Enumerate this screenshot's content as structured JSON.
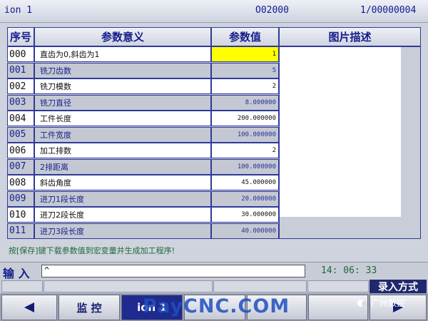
{
  "titlebar": {
    "left": "ion 1",
    "middle": "O02000",
    "right": "1/00000004"
  },
  "table": {
    "headers": {
      "no": "序号",
      "meaning": "参数意义",
      "value": "参数值",
      "image": "图片描述"
    },
    "rows": [
      {
        "no": "000",
        "name": "直齿为0,斜齿为1",
        "value": "1"
      },
      {
        "no": "001",
        "name": "铣刀齿数",
        "value": "5"
      },
      {
        "no": "002",
        "name": "铣刀模数",
        "value": "2"
      },
      {
        "no": "003",
        "name": "铣刀直径",
        "value": "8.000000"
      },
      {
        "no": "004",
        "name": "工件长度",
        "value": "200.000000"
      },
      {
        "no": "005",
        "name": "工件宽度",
        "value": "100.000000"
      },
      {
        "no": "006",
        "name": "加工排数",
        "value": "2"
      },
      {
        "no": "007",
        "name": "2排距离",
        "value": "100.000000"
      },
      {
        "no": "008",
        "name": "斜齿角度",
        "value": "45.000000"
      },
      {
        "no": "009",
        "name": "进刀1段长度",
        "value": "20.000000"
      },
      {
        "no": "010",
        "name": "进刀2段长度",
        "value": "30.000000"
      },
      {
        "no": "011",
        "name": "进刀3段长度",
        "value": "40.000000"
      }
    ]
  },
  "hint": "按[保存]键下载参数值到宏变量并生成加工程序!",
  "input": {
    "label": "输 入",
    "value": "^"
  },
  "clock": "14: 06: 33",
  "mode": "录入方式",
  "softkeys": {
    "monitor": "监 控",
    "active": "ion 1"
  },
  "watermark": "PayCNC.COM",
  "watermark2": "广州数控",
  "colors": {
    "highlight": "#ffff00",
    "header_text": "#141c8a",
    "active_key": "#1f2a8e"
  }
}
